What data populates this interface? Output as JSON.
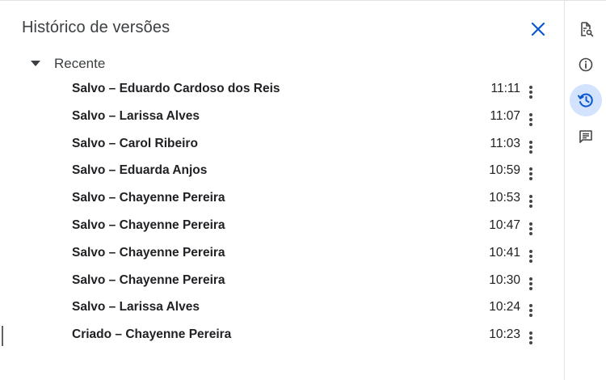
{
  "panel": {
    "title": "Histórico de versões",
    "close_icon": "close-icon"
  },
  "section": {
    "label": "Recente",
    "expanded": true
  },
  "versions": [
    {
      "label": "Salvo – Eduardo Cardoso dos Reis",
      "time": "11:11"
    },
    {
      "label": "Salvo – Larissa Alves",
      "time": "11:07"
    },
    {
      "label": "Salvo – Carol Ribeiro",
      "time": "11:03"
    },
    {
      "label": "Salvo – Eduarda Anjos",
      "time": "10:59"
    },
    {
      "label": "Salvo – Chayenne Pereira",
      "time": "10:53"
    },
    {
      "label": "Salvo – Chayenne Pereira",
      "time": "10:47"
    },
    {
      "label": "Salvo – Chayenne Pereira",
      "time": "10:41"
    },
    {
      "label": "Salvo – Chayenne Pereira",
      "time": "10:30"
    },
    {
      "label": "Salvo – Larissa Alves",
      "time": "10:24"
    },
    {
      "label": "Criado – Chayenne Pereira",
      "time": "10:23"
    }
  ],
  "sidebar": {
    "items": [
      {
        "icon": "document-search-icon",
        "active": false
      },
      {
        "icon": "info-icon",
        "active": false
      },
      {
        "icon": "version-history-icon",
        "active": true
      },
      {
        "icon": "comments-icon",
        "active": false
      }
    ]
  },
  "colors": {
    "accent": "#0b57d0",
    "active_bg": "#d3e3fd",
    "text": "#202124",
    "icon": "#444746"
  }
}
